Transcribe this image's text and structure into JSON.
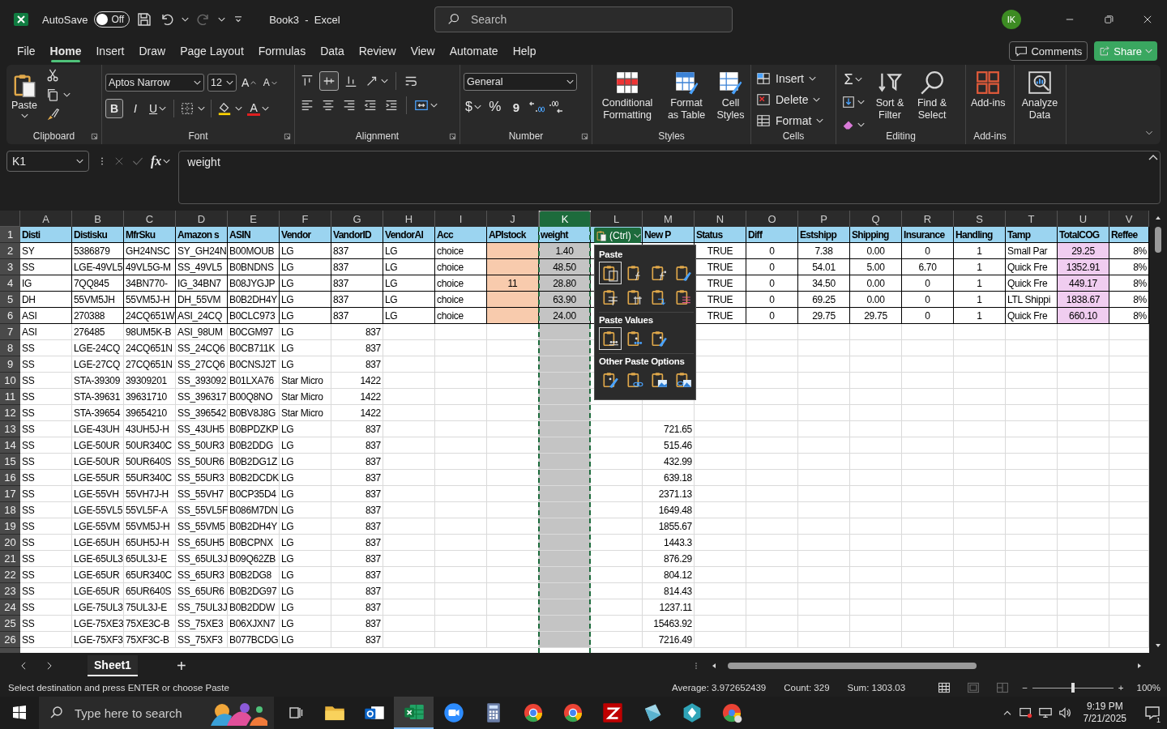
{
  "title_bar": {
    "autosave_label": "AutoSave",
    "autosave": {
      "on": false,
      "label": "Off"
    },
    "redo": {
      "disabled": true
    },
    "title": "Book3  -  Excel",
    "search": {
      "placeholder": "Search"
    },
    "avatar": "IK"
  },
  "menu": {
    "tabs": [
      {
        "label": "File",
        "selected": false
      },
      {
        "label": "Home",
        "selected": true
      },
      {
        "label": "Insert",
        "selected": false
      },
      {
        "label": "Draw",
        "selected": false
      },
      {
        "label": "Page Layout",
        "selected": false
      },
      {
        "label": "Formulas",
        "selected": false
      },
      {
        "label": "Data",
        "selected": false
      },
      {
        "label": "Review",
        "selected": false
      },
      {
        "label": "View",
        "selected": false
      },
      {
        "label": "Automate",
        "selected": false
      },
      {
        "label": "Help",
        "selected": false
      }
    ],
    "comments": "Comments",
    "share": "Share"
  },
  "ribbon": {
    "groups": [
      {
        "kind": "clipboard",
        "label": "Clipboard",
        "launcher": true,
        "paste": "Paste"
      },
      {
        "kind": "font",
        "label": "Font",
        "launcher": true,
        "font": "Aptos Narrow",
        "size": "12",
        "grow": "A",
        "shrink": "A",
        "bold": {
          "label": "B",
          "on": true
        },
        "italic": "I",
        "underline": "U",
        "font_color": "A"
      },
      {
        "kind": "alignment",
        "label": "Alignment",
        "launcher": true,
        "top": [
          {
            "kind": "top",
            "selected": false
          },
          {
            "kind": "middle",
            "selected": true
          },
          {
            "kind": "bottom",
            "selected": false
          },
          {
            "kind": "orientation",
            "selected": false
          },
          {
            "kind": "wrap",
            "selected": false
          }
        ],
        "bottom": [
          {
            "kind": "left",
            "selected": false
          },
          {
            "kind": "center",
            "selected": false
          },
          {
            "kind": "right",
            "selected": false
          },
          {
            "kind": "outdent",
            "selected": false
          },
          {
            "kind": "indent",
            "selected": false
          },
          {
            "kind": "merge",
            "selected": false
          }
        ]
      },
      {
        "kind": "number",
        "label": "Number",
        "launcher": true,
        "format": "General",
        "currency": "$",
        "percent": "%",
        "comma": "9"
      },
      {
        "kind": "styles",
        "label": "Styles",
        "items": [
          "Conditional Formatting",
          "Format as Table",
          "Cell Styles"
        ]
      },
      {
        "kind": "cells",
        "label": "Cells",
        "items": [
          "Insert",
          "Delete",
          "Format"
        ]
      },
      {
        "kind": "editing",
        "label": "Editing",
        "sum": "Σ",
        "sort": "Sort & Filter",
        "find": "Find & Select"
      },
      {
        "kind": "addins",
        "label": "Add-ins",
        "button": "Add-ins"
      },
      {
        "kind": "analyze",
        "button": "Analyze Data"
      }
    ]
  },
  "formula_bar": {
    "name_box": "K1",
    "fx": "fx",
    "formula": "weight"
  },
  "sheet": {
    "columns": [
      {
        "label": "A",
        "selected": false
      },
      {
        "label": "B",
        "selected": false
      },
      {
        "label": "C",
        "selected": false
      },
      {
        "label": "D",
        "selected": false
      },
      {
        "label": "E",
        "selected": false
      },
      {
        "label": "F",
        "selected": false
      },
      {
        "label": "G",
        "selected": false
      },
      {
        "label": "H",
        "selected": false
      },
      {
        "label": "I",
        "selected": false
      },
      {
        "label": "J",
        "selected": false
      },
      {
        "label": "K",
        "selected": true
      },
      {
        "label": "L",
        "selected": false
      },
      {
        "label": "M",
        "selected": false
      },
      {
        "label": "N",
        "selected": false
      },
      {
        "label": "O",
        "selected": false
      },
      {
        "label": "P",
        "selected": false
      },
      {
        "label": "Q",
        "selected": false
      },
      {
        "label": "R",
        "selected": false
      },
      {
        "label": "S",
        "selected": false
      },
      {
        "label": "T",
        "selected": false
      },
      {
        "label": "U",
        "selected": false
      },
      {
        "label": "V",
        "selected": false
      }
    ],
    "rows": [
      {
        "number": "1",
        "kind": "header",
        "cells": [
          "Disti",
          "Distisku",
          "MfrSku",
          "Amazon s",
          "ASIN",
          "Vendor",
          "VandorID",
          "VendorAl",
          "Acc",
          "APIstock",
          "weight",
          null,
          "New P",
          "Status",
          "Diff",
          "Estshipp",
          "Shipping",
          "Insurance",
          "Handling",
          "Tamp",
          "TotalCOG",
          "Reffee"
        ]
      },
      {
        "number": "2",
        "kind": "table",
        "cells": [
          "SY",
          "5386879",
          "GH24NSC",
          "SY_GH24N",
          "B00MOUB",
          "LG",
          "837",
          "LG",
          "choice",
          null,
          "1.40",
          null,
          null,
          "TRUE",
          "0",
          "7.38",
          "0.00",
          "0",
          "1",
          "Small Par",
          "29.25",
          "8%"
        ]
      },
      {
        "number": "3",
        "kind": "table",
        "cells": [
          "SS",
          "LGE-49VL5",
          "49VL5G-M",
          "SS_49VL5",
          "B0BNDNS",
          "LG",
          "837",
          "LG",
          "choice",
          null,
          "48.50",
          null,
          null,
          "TRUE",
          "0",
          "54.01",
          "5.00",
          "6.70",
          "1",
          "Quick Fre",
          "1352.91",
          "8%"
        ]
      },
      {
        "number": "4",
        "kind": "table",
        "cells": [
          "IG",
          "7QQ845",
          "34BN770-",
          "IG_34BN7",
          "B08JYGJP",
          "LG",
          "837",
          "LG",
          "choice",
          "11",
          "28.80",
          null,
          null,
          "TRUE",
          "0",
          "34.50",
          "0.00",
          "0",
          "1",
          "Quick Fre",
          "449.17",
          "8%"
        ]
      },
      {
        "number": "5",
        "kind": "table",
        "cells": [
          "DH",
          "55VM5JH",
          "55VM5J-H",
          "DH_55VM",
          "B0B2DH4Y",
          "LG",
          "837",
          "LG",
          "choice",
          null,
          "63.90",
          null,
          null,
          "TRUE",
          "0",
          "69.25",
          "0.00",
          "0",
          "1",
          "LTL Shippi",
          "1838.67",
          "8%"
        ]
      },
      {
        "number": "6",
        "kind": "table",
        "cells": [
          "ASI",
          "270388",
          "24CQ651W",
          "ASI_24CQ",
          "B0CLC973",
          "LG",
          "837",
          "LG",
          "choice",
          null,
          "24.00",
          null,
          null,
          "TRUE",
          "0",
          "29.75",
          "29.75",
          "0",
          "1",
          "Quick Fre",
          "660.10",
          "8%"
        ]
      },
      {
        "number": "7",
        "kind": "plain",
        "cells": [
          "ASI",
          "276485",
          "98UM5K-B",
          "ASI_98UM",
          "B0CGM97",
          "LG",
          "837"
        ]
      },
      {
        "number": "8",
        "kind": "plain",
        "cells": [
          "SS",
          "LGE-24CQ",
          "24CQ651N",
          "SS_24CQ6",
          "B0CB711K",
          "LG",
          "837"
        ]
      },
      {
        "number": "9",
        "kind": "plain",
        "cells": [
          "SS",
          "LGE-27CQ",
          "27CQ651N",
          "SS_27CQ6",
          "B0CNSJ2T",
          "LG",
          "837"
        ]
      },
      {
        "number": "10",
        "kind": "plain",
        "cells": [
          "SS",
          "STA-39309",
          "39309201",
          "SS_393092",
          "B01LXA76",
          "Star Micro",
          "1422"
        ]
      },
      {
        "number": "11",
        "kind": "plain",
        "cells": [
          "SS",
          "STA-39631",
          "39631710",
          "SS_396317",
          "B00Q8NO",
          "Star Micro",
          "1422"
        ]
      },
      {
        "number": "12",
        "kind": "plain",
        "cells": [
          "SS",
          "STA-39654",
          "39654210",
          "SS_396542",
          "B0BV8J8G",
          "Star Micro",
          "1422"
        ]
      },
      {
        "number": "13",
        "kind": "plain",
        "cells": [
          "SS",
          "LGE-43UH",
          "43UH5J-H",
          "SS_43UH5",
          "B0BPDZKP",
          "LG",
          "837",
          null,
          null,
          null,
          null,
          null,
          "721.65"
        ]
      },
      {
        "number": "14",
        "kind": "plain",
        "cells": [
          "SS",
          "LGE-50UR",
          "50UR340C",
          "SS_50UR3",
          "B0B2DDG",
          "LG",
          "837",
          null,
          null,
          null,
          null,
          null,
          "515.46"
        ]
      },
      {
        "number": "15",
        "kind": "plain",
        "cells": [
          "SS",
          "LGE-50UR",
          "50UR640S",
          "SS_50UR6",
          "B0B2DG1Z",
          "LG",
          "837",
          null,
          null,
          null,
          null,
          null,
          "432.99"
        ]
      },
      {
        "number": "16",
        "kind": "plain",
        "cells": [
          "SS",
          "LGE-55UR",
          "55UR340C",
          "SS_55UR3",
          "B0B2DCDK",
          "LG",
          "837",
          null,
          null,
          null,
          null,
          null,
          "639.18"
        ]
      },
      {
        "number": "17",
        "kind": "plain",
        "cells": [
          "SS",
          "LGE-55VH",
          "55VH7J-H",
          "SS_55VH7",
          "B0CP35D4",
          "LG",
          "837",
          null,
          null,
          null,
          null,
          null,
          "2371.13"
        ]
      },
      {
        "number": "18",
        "kind": "plain",
        "cells": [
          "SS",
          "LGE-55VL5",
          "55VL5F-A",
          "SS_55VL5F",
          "B086M7DN",
          "LG",
          "837",
          null,
          null,
          null,
          null,
          null,
          "1649.48"
        ]
      },
      {
        "number": "19",
        "kind": "plain",
        "cells": [
          "SS",
          "LGE-55VM",
          "55VM5J-H",
          "SS_55VM5",
          "B0B2DH4Y",
          "LG",
          "837",
          null,
          null,
          null,
          null,
          null,
          "1855.67"
        ]
      },
      {
        "number": "20",
        "kind": "plain",
        "cells": [
          "SS",
          "LGE-65UH",
          "65UH5J-H",
          "SS_65UH5",
          "B0BCPNX",
          "LG",
          "837",
          null,
          null,
          null,
          null,
          null,
          "1443.3"
        ]
      },
      {
        "number": "21",
        "kind": "plain",
        "cells": [
          "SS",
          "LGE-65UL3",
          "65UL3J-E",
          "SS_65UL3J",
          "B09Q62ZB",
          "LG",
          "837",
          null,
          null,
          null,
          null,
          null,
          "876.29"
        ]
      },
      {
        "number": "22",
        "kind": "plain",
        "cells": [
          "SS",
          "LGE-65UR",
          "65UR340C",
          "SS_65UR3",
          "B0B2DG8",
          "LG",
          "837",
          null,
          null,
          null,
          null,
          null,
          "804.12"
        ]
      },
      {
        "number": "23",
        "kind": "plain",
        "cells": [
          "SS",
          "LGE-65UR",
          "65UR640S",
          "SS_65UR6",
          "B0B2DG97",
          "LG",
          "837",
          null,
          null,
          null,
          null,
          null,
          "814.43"
        ]
      },
      {
        "number": "24",
        "kind": "plain",
        "cells": [
          "SS",
          "LGE-75UL3",
          "75UL3J-E",
          "SS_75UL3J",
          "B0B2DDW",
          "LG",
          "837",
          null,
          null,
          null,
          null,
          null,
          "1237.11"
        ]
      },
      {
        "number": "25",
        "kind": "plain",
        "cells": [
          "SS",
          "LGE-75XE3",
          "75XE3C-B",
          "SS_75XE3",
          "B06XJXN7",
          "LG",
          "837",
          null,
          null,
          null,
          null,
          null,
          "15463.92"
        ]
      },
      {
        "number": "26",
        "kind": "plain",
        "cells": [
          "SS",
          "LGE-75XF3",
          "75XF3C-B",
          "SS_75XF3",
          "B077BCDG",
          "LG",
          "837",
          null,
          null,
          null,
          null,
          null,
          "7216.49"
        ]
      }
    ],
    "paste_options": {
      "button": "(Ctrl)",
      "sections": [
        {
          "title": "Paste",
          "items": [
            {
              "kind": "paste",
              "selected": true
            },
            {
              "kind": "formulas",
              "selected": false
            },
            {
              "kind": "formulas-format",
              "selected": false
            },
            {
              "kind": "keep-source",
              "selected": false
            },
            {
              "kind": "no-borders",
              "selected": false
            },
            {
              "kind": "col-widths",
              "selected": false
            },
            {
              "kind": "transpose",
              "selected": false
            },
            {
              "kind": "merge-format",
              "selected": false
            }
          ]
        },
        {
          "title": "Paste Values",
          "items": [
            {
              "kind": "values",
              "selected": true
            },
            {
              "kind": "values-format",
              "selected": false
            },
            {
              "kind": "values-source",
              "selected": false
            }
          ]
        },
        {
          "title": "Other Paste Options",
          "items": [
            {
              "kind": "formatting",
              "selected": false
            },
            {
              "kind": "link",
              "selected": false
            },
            {
              "kind": "picture",
              "selected": false
            },
            {
              "kind": "linked-picture",
              "selected": false
            }
          ]
        }
      ]
    }
  },
  "sheet_tabs": [
    {
      "label": "Sheet1",
      "selected": true
    }
  ],
  "add_sheet": "+",
  "status_bar": {
    "message": "Select destination and press ENTER or choose Paste",
    "average": "Average: 3.972652439",
    "count": "Count: 329",
    "sum": "Sum: 1303.03",
    "views": [
      {
        "kind": "normal",
        "selected": true
      },
      {
        "kind": "page-layout",
        "selected": false
      },
      {
        "kind": "page-break",
        "selected": false
      }
    ],
    "zoom": {
      "out": "−",
      "in": "+",
      "level": 0.5,
      "reading": "100%"
    }
  },
  "taskbar": {
    "search": {
      "placeholder": "Type here to search"
    },
    "apps": [
      {
        "kind": "folder",
        "selected": false
      },
      {
        "kind": "mail",
        "selected": false
      },
      {
        "kind": "sheet",
        "selected": true
      },
      {
        "kind": "video",
        "selected": false
      },
      {
        "kind": "calculator",
        "selected": false
      },
      {
        "kind": "browser",
        "selected": false
      },
      {
        "kind": "browser",
        "selected": false
      },
      {
        "kind": "ftp",
        "selected": false
      },
      {
        "kind": "glass",
        "selected": false
      },
      {
        "kind": "cube",
        "selected": false
      },
      {
        "kind": "browser-user",
        "selected": false
      }
    ],
    "time": "9:19 PM",
    "date": "7/21/2025",
    "notifications": "1"
  }
}
